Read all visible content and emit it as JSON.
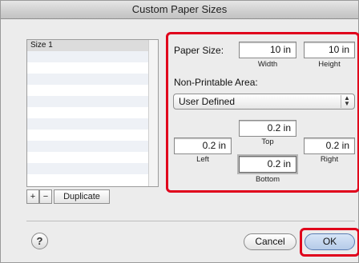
{
  "window": {
    "title": "Custom Paper Sizes"
  },
  "list": {
    "rows": [
      "Size 1",
      "",
      "",
      "",
      "",
      "",
      "",
      "",
      "",
      "",
      "",
      "",
      ""
    ]
  },
  "list_buttons": {
    "add": "+",
    "remove": "−",
    "duplicate": "Duplicate"
  },
  "paper_size": {
    "label": "Paper Size:",
    "width_value": "10 in",
    "height_value": "10 in",
    "width_caption": "Width",
    "height_caption": "Height"
  },
  "non_printable": {
    "label": "Non-Printable Area:",
    "selected": "User Defined",
    "top_value": "0.2 in",
    "top_caption": "Top",
    "left_value": "0.2 in",
    "left_caption": "Left",
    "right_value": "0.2 in",
    "right_caption": "Right",
    "bottom_value": "0.2 in",
    "bottom_caption": "Bottom"
  },
  "footer": {
    "help": "?",
    "cancel": "Cancel",
    "ok": "OK"
  },
  "colors": {
    "highlight": "#e0001b",
    "default_button": "#b5cbe8"
  }
}
